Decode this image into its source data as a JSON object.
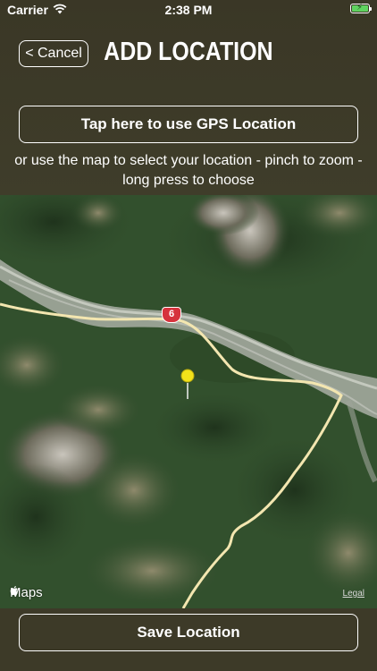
{
  "status_bar": {
    "carrier": "Carrier",
    "time": "2:38 PM"
  },
  "header": {
    "cancel_label": "< Cancel",
    "title": "ADD LOCATION",
    "gps_button_label": "Tap here to use GPS Location",
    "instructions": "or use the map to select your location - pinch to zoom - long press to choose"
  },
  "map": {
    "route_badge": "6",
    "attribution": "Maps",
    "legal_label": "Legal",
    "pin_color": "#f2e21a",
    "road_color": "#f3e6b0"
  },
  "footer": {
    "save_label": "Save Location"
  },
  "colors": {
    "accent_bg": "#3d3a28"
  }
}
